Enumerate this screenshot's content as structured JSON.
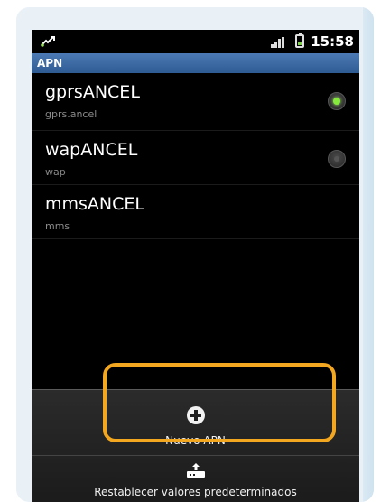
{
  "status_bar": {
    "time": "15:58",
    "icons": [
      "usb-debug-icon",
      "signal-icon",
      "battery-icon"
    ]
  },
  "title_bar": {
    "title": "APN"
  },
  "apn_list": [
    {
      "name": "gprsANCEL",
      "value": "gprs.ancel",
      "selected": true
    },
    {
      "name": "wapANCEL",
      "value": "wap",
      "selected": false
    },
    {
      "name": "mmsANCEL",
      "value": "mms",
      "selected": false
    }
  ],
  "menu": {
    "new_apn_label": "Nuevo APN",
    "reset_label": "Restablecer valores predeterminados"
  },
  "colors": {
    "accent_highlight": "#f3a61f",
    "radio_active": "#86e93e",
    "titlebar": "#3a6aa6"
  }
}
